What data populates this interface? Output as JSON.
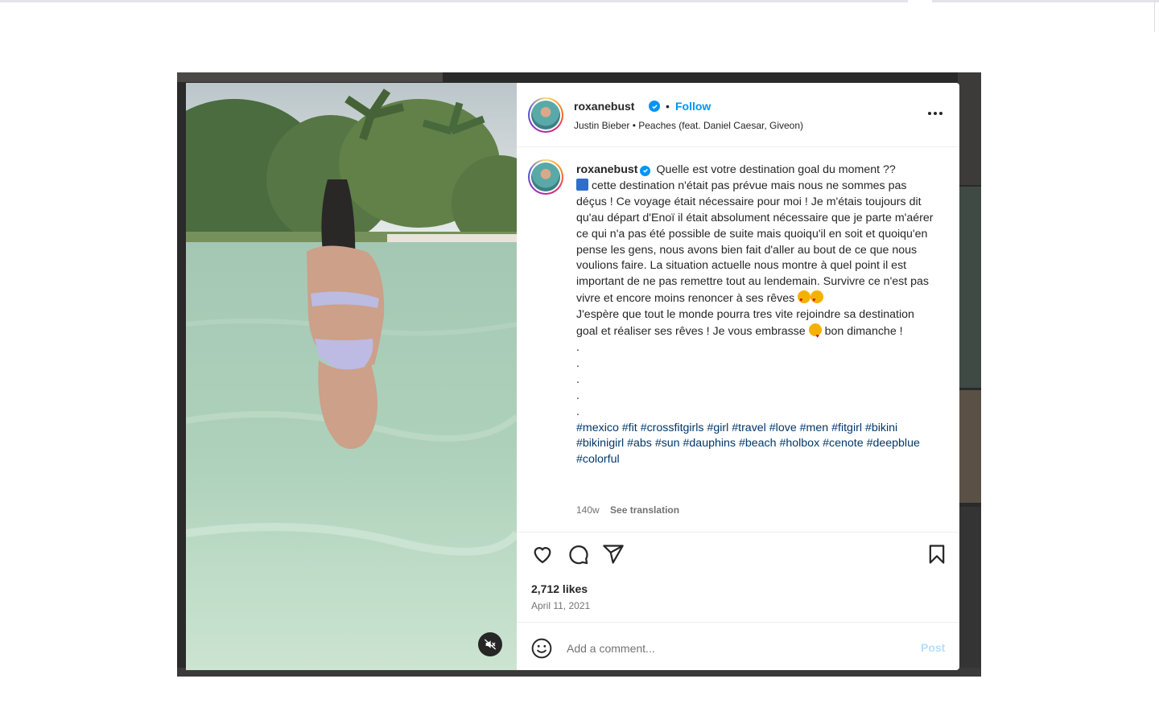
{
  "post": {
    "username": "roxanebust",
    "follow_label": "Follow",
    "separator": "•",
    "audio": "Justin Bieber • Peaches (feat. Daniel Caesar, Giveon)",
    "caption": {
      "username": "roxanebust",
      "line1": "Quelle est votre destination goal du moment ??",
      "line2": "cette destination n'était pas prévue mais nous ne sommes pas déçus ! Ce voyage était nécessaire pour moi ! Je m'étais toujours dit qu'au départ d'Enoï il était absolument nécessaire que je parte m'aérer ce qui n'a pas été possible de suite mais quoiqu'il en soit et quoiqu'en pense les gens, nous avons bien fait d'aller au bout de ce que nous voulions faire. La situation actuelle nous montre à quel point il est important de ne pas remettre tout au lendemain. Survivre ce n'est pas vivre et encore moins renoncer à ses rêves",
      "line3": "J'espère que tout le monde pourra tres vite rejoindre sa destination goal et réaliser ses rêves ! Je vous embrasse",
      "line3_end": "bon dimanche !",
      "dots": [
        ".",
        ".",
        ".",
        ".",
        "."
      ],
      "hashtags": [
        "#mexico",
        "#fit",
        "#crossfitgirls",
        "#girl",
        "#travel",
        "#love",
        "#men",
        "#fitgirl",
        "#bikini",
        "#bikinigirl",
        "#abs",
        "#sun",
        "#dauphins",
        "#beach",
        "#holbox",
        "#cenote",
        "#deepblue",
        "#colorful"
      ]
    },
    "age": "140w",
    "see_translation": "See translation",
    "likes": "2,712 likes",
    "date": "April 11, 2021",
    "comment_placeholder": "Add a comment...",
    "post_label": "Post"
  },
  "icons": [
    "verified-icon",
    "more-icon",
    "heart-icon",
    "comment-icon",
    "share-icon",
    "bookmark-icon",
    "emoji-icon",
    "muted-icon"
  ],
  "colors": {
    "accent": "#0095f6",
    "hashtag": "#00376b",
    "muted_text": "#737373",
    "post_disabled": "#b2dffc"
  }
}
